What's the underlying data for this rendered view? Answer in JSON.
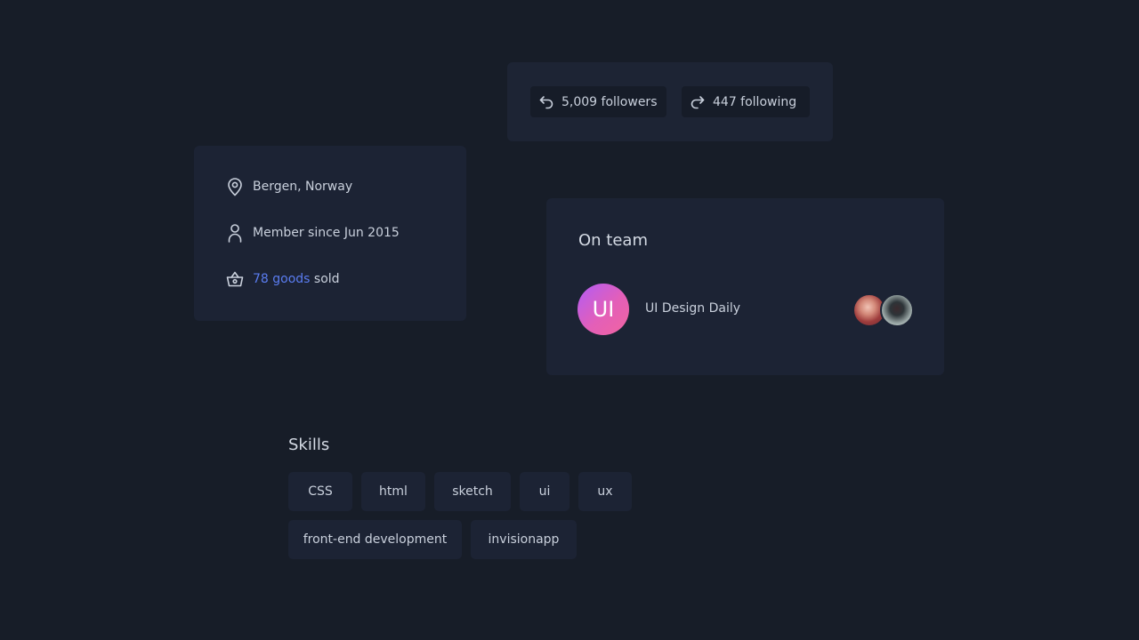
{
  "follow": {
    "followers_label": "5,009 followers",
    "following_label": "447 following"
  },
  "info": {
    "location": "Bergen, Norway",
    "member_since": "Member since Jun 2015",
    "goods_link": "78 goods",
    "goods_suffix": " sold"
  },
  "team": {
    "heading": "On team",
    "logo_text": "UI",
    "name": "UI Design Daily"
  },
  "skills": {
    "heading": "Skills",
    "tags": [
      "CSS",
      "html",
      "sketch",
      "ui",
      "ux",
      "front-end development",
      "invisionapp"
    ]
  },
  "icons": {
    "followers": "reply-arrow-icon",
    "following": "forward-arrow-icon",
    "location": "location-pin-icon",
    "member": "user-icon",
    "sold": "basket-icon"
  },
  "colors": {
    "background": "#171d28",
    "card": "#1c2334",
    "accent_link": "#5a7cf0"
  }
}
